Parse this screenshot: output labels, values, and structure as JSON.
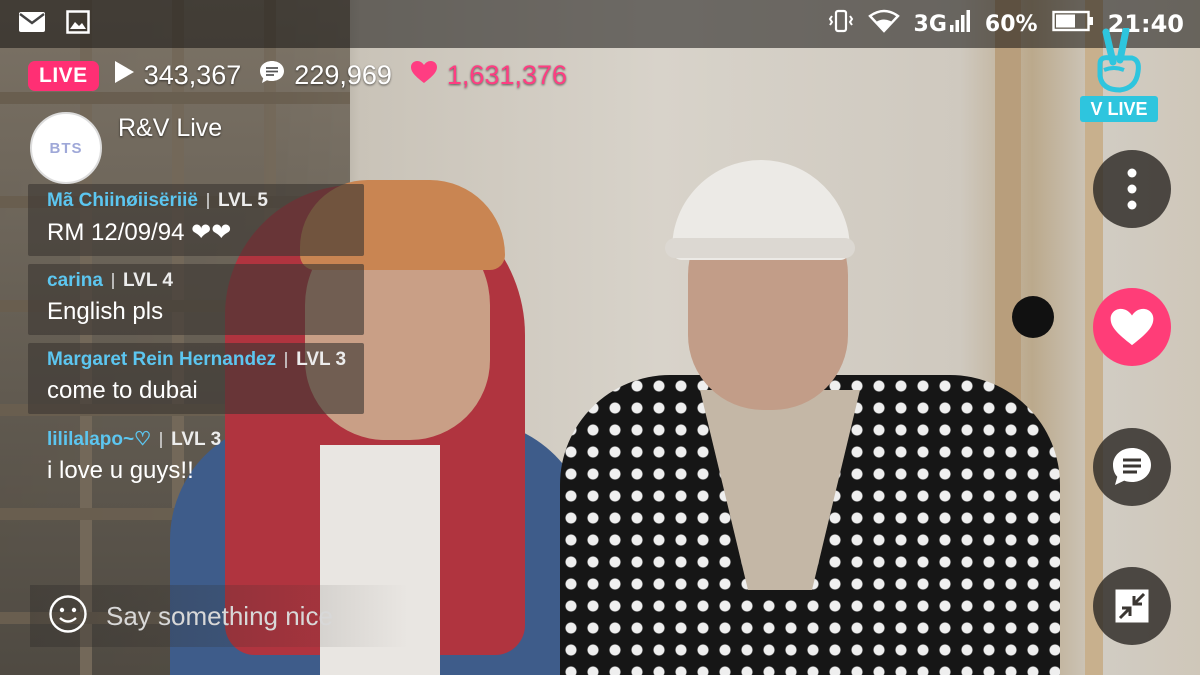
{
  "status_bar": {
    "network": "3G",
    "battery": "60%",
    "time": "21:40",
    "icons": [
      "mail-icon",
      "gallery-icon",
      "vibrate-icon",
      "wifi-icon",
      "signal-icon",
      "battery-icon"
    ]
  },
  "broadcast": {
    "live_label": "LIVE",
    "views": "343,367",
    "comments": "229,969",
    "likes": "1,631,376",
    "channel_name": "R&V Live",
    "channel_avatar_text": "BTS"
  },
  "chat": [
    {
      "user": "Mã Chiinøiisëriië",
      "level": "LVL 5",
      "text": "RM 12/09/94 ❤❤"
    },
    {
      "user": "carina",
      "level": "LVL 4",
      "text": "English pls"
    },
    {
      "user": "Margaret Rein Hernandez",
      "level": "LVL 3",
      "text": "come  to dubai"
    },
    {
      "user": "lililalapo~♡",
      "level": "LVL 3",
      "text": "i love u guys!!"
    }
  ],
  "input": {
    "placeholder": "Say something nice"
  },
  "logo": {
    "label": "V LIVE"
  },
  "colors": {
    "live_pink": "#ff2f74",
    "heart_pink": "#ff3d78",
    "username_blue": "#5cc6f0",
    "vlive_cyan": "#2ec5de"
  }
}
